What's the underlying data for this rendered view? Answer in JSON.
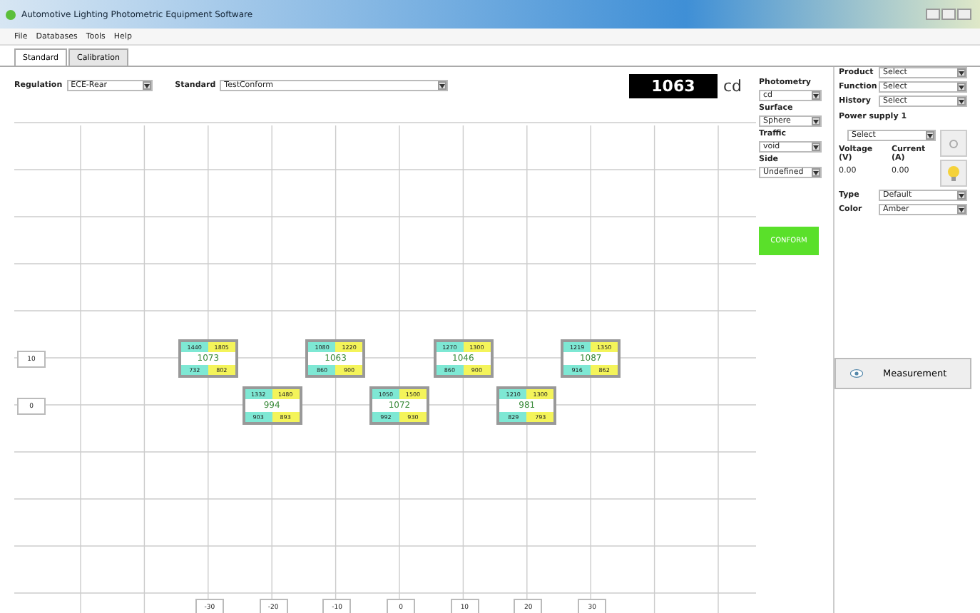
{
  "window": {
    "title": "Automotive Lighting Photometric Equipment Software"
  },
  "menu": [
    "File",
    "Databases",
    "Tools",
    "Help"
  ],
  "tabs": [
    {
      "label": "Standard",
      "selected": true
    },
    {
      "label": "Calibration",
      "selected": false
    }
  ],
  "regulation": {
    "label": "Regulation",
    "value": "ECE-Rear"
  },
  "standard": {
    "label": "Standard",
    "value": "TestConform"
  },
  "reading": {
    "value": "1063",
    "unit": "cd"
  },
  "photometry": [
    {
      "label": "Photometry",
      "value": "cd"
    },
    {
      "label": "Surface",
      "value": "Sphere"
    },
    {
      "label": "Traffic",
      "value": "void"
    },
    {
      "label": "Side",
      "value": "Undefined"
    }
  ],
  "status": {
    "label": "CONFORM",
    "conform": true
  },
  "selectors": [
    {
      "label": "Product",
      "value": "Select"
    },
    {
      "label": "Function",
      "value": "Select"
    },
    {
      "label": "History",
      "value": "Select"
    }
  ],
  "power_supply": {
    "title": "Power supply 1",
    "value": "Select",
    "voltage_label": "Voltage (V)",
    "current_label": "Current (A)",
    "voltage": "0.00",
    "current": "0.00",
    "lamp_on": true
  },
  "lamp": [
    {
      "label": "Type",
      "value": "Default"
    },
    {
      "label": "Color",
      "value": "Amber"
    }
  ],
  "measurement_button": "Measurement",
  "grid": {
    "x_labels": [
      "-30",
      "-20",
      "-10",
      "0",
      "10",
      "20",
      "30"
    ],
    "rows": [
      {
        "label": "10",
        "cells": [
          {
            "value": "1073",
            "corners": [
              "1440",
              "1805",
              "732",
              "802"
            ]
          },
          null,
          {
            "value": "1063",
            "corners": [
              "1080",
              "1220",
              "860",
              "900"
            ]
          },
          null,
          {
            "value": "1046",
            "corners": [
              "1270",
              "1300",
              "860",
              "900"
            ]
          },
          null,
          {
            "value": "1087",
            "corners": [
              "1219",
              "1350",
              "916",
              "862"
            ]
          }
        ]
      },
      {
        "label": "0",
        "cells": [
          null,
          {
            "value": "994",
            "corners": [
              "1332",
              "1480",
              "903",
              "893"
            ]
          },
          null,
          {
            "value": "1072",
            "corners": [
              "1050",
              "1500",
              "992",
              "930"
            ]
          },
          null,
          {
            "value": "981",
            "corners": [
              "1210",
              "1300",
              "829",
              "793"
            ]
          },
          null
        ]
      }
    ]
  }
}
